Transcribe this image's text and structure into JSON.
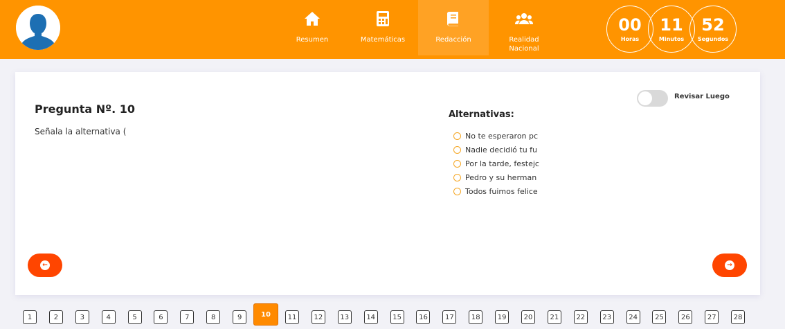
{
  "header": {
    "nav": [
      {
        "label": "Resumen",
        "icon": "home-icon",
        "active": false
      },
      {
        "label": "Matemáticas",
        "icon": "calculator-icon",
        "active": false
      },
      {
        "label": "Redacción",
        "icon": "book-icon",
        "active": true
      },
      {
        "label": "Realidad Nacional",
        "icon": "group-icon",
        "active": false
      }
    ],
    "timer": {
      "hours": "00",
      "hours_label": "Horas",
      "minutes": "11",
      "minutes_label": "Minutos",
      "seconds": "52",
      "seconds_label": "Segundos"
    }
  },
  "question": {
    "title": "Pregunta Nº. 10",
    "text": "Señala la alternativa ("
  },
  "review": {
    "label": "Revisar Luego",
    "checked": false
  },
  "alternatives": {
    "title": "Alternativas:",
    "items": [
      "No te esperaron pc",
      "Nadie decidió tu fu",
      "Por la tarde, festejc",
      "Pedro y su herman",
      "Todos fuimos felice"
    ]
  },
  "pager": {
    "current": "10",
    "pages": [
      "1",
      "2",
      "3",
      "4",
      "5",
      "6",
      "7",
      "8",
      "9",
      "10",
      "11",
      "12",
      "13",
      "14",
      "15",
      "16",
      "17",
      "18",
      "19",
      "20",
      "21",
      "22",
      "23",
      "24",
      "25",
      "26",
      "27",
      "28"
    ]
  },
  "colors": {
    "header": "#ff9400",
    "accent": "#ff4500",
    "current_page": "#ff8a00"
  }
}
